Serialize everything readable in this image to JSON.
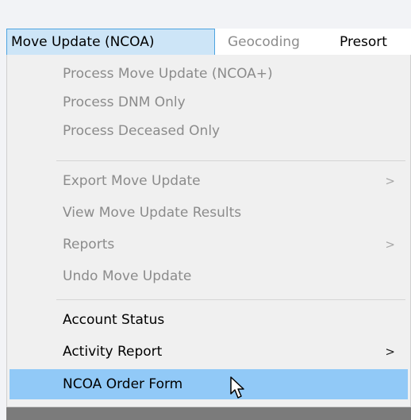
{
  "menubar": {
    "items": [
      {
        "label": "Move Update (NCOA)"
      },
      {
        "label": "Geocoding"
      },
      {
        "label": "Presort"
      }
    ]
  },
  "dropdown": {
    "items": [
      {
        "label": "Process Move Update (NCOA+)"
      },
      {
        "label": "Process DNM Only"
      },
      {
        "label": "Process Deceased Only"
      },
      {
        "label": "Export Move Update",
        "arrow": ">"
      },
      {
        "label": "View Move Update Results"
      },
      {
        "label": "Reports",
        "arrow": ">"
      },
      {
        "label": "Undo Move Update"
      },
      {
        "label": "Account Status"
      },
      {
        "label": "Activity Report",
        "arrow": ">"
      },
      {
        "label": "NCOA Order Form"
      }
    ]
  },
  "colors": {
    "highlight": "#91c9f7",
    "active_menubar": "#cde5f7",
    "disabled_text": "#8b8b8b"
  },
  "icons": {
    "cursor": "mouse-pointer-icon"
  }
}
